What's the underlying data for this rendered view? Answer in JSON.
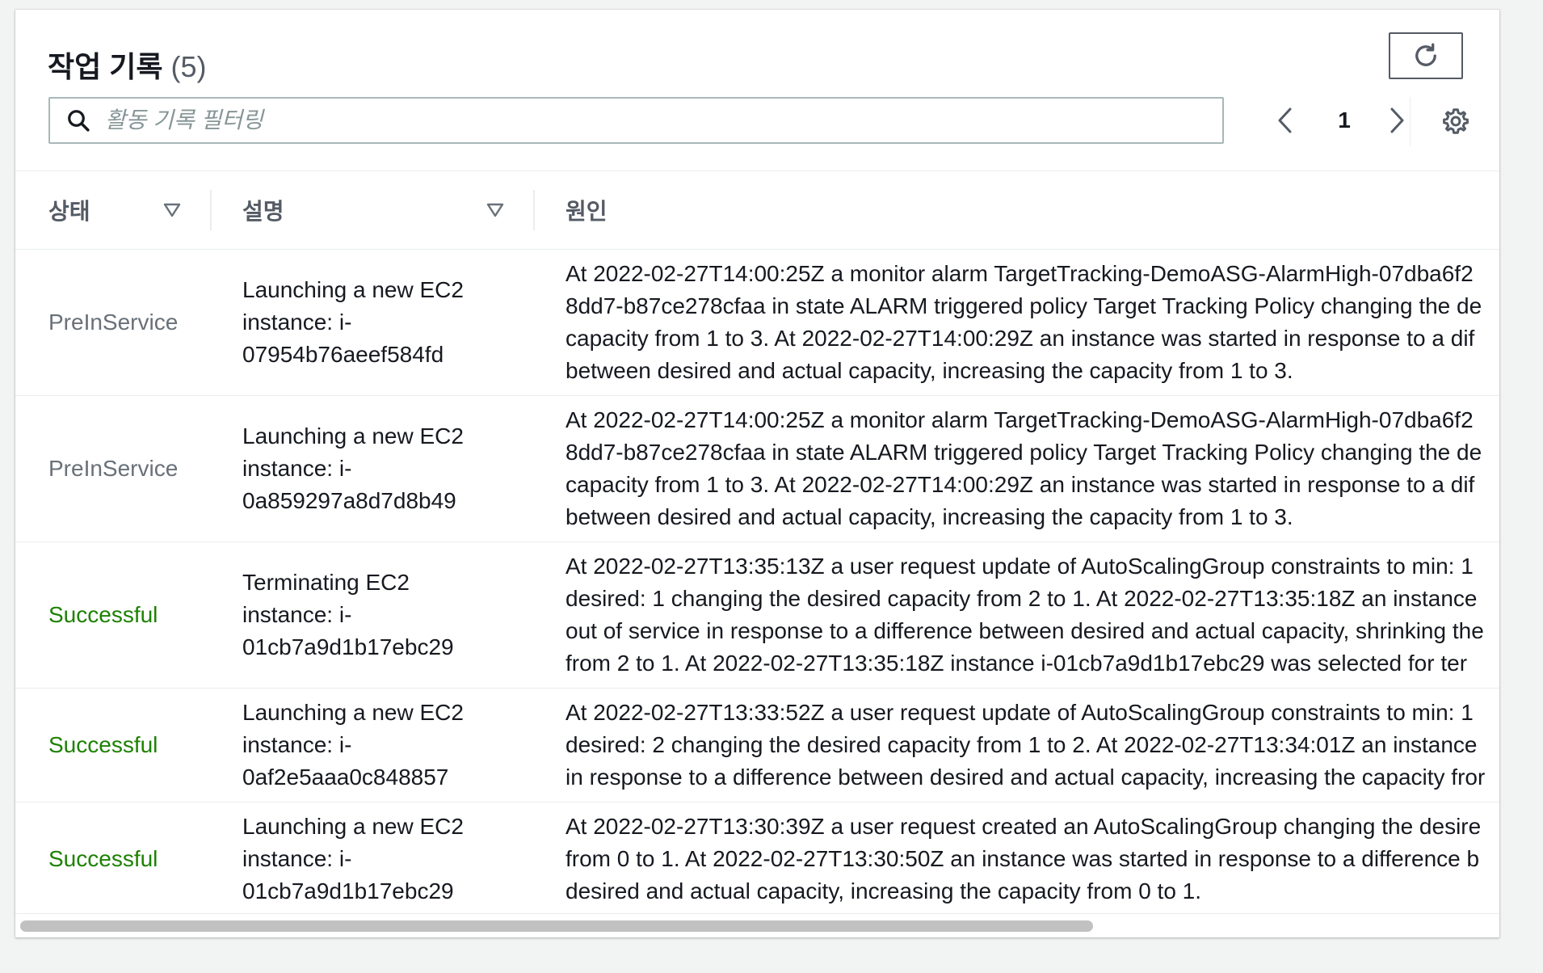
{
  "header": {
    "title": "작업 기록",
    "count": "(5)"
  },
  "search": {
    "placeholder": "활동 기록 필터링",
    "value": ""
  },
  "pagination": {
    "current_page": "1"
  },
  "icons": {
    "refresh": "refresh-icon",
    "search": "search-icon",
    "prev": "chevron-left-icon",
    "next": "chevron-right-icon",
    "settings": "gear-icon",
    "sort": "caret-down-icon"
  },
  "colors": {
    "status_preinservice": "#687078",
    "status_successful": "#1d8102"
  },
  "table": {
    "columns": [
      {
        "label": "상태",
        "sortable": true
      },
      {
        "label": "설명",
        "sortable": true
      },
      {
        "label": "원인",
        "sortable": false
      }
    ],
    "rows": [
      {
        "status": "PreInService",
        "status_type": "pre",
        "description": [
          "Launching a new EC2",
          "instance: i-",
          "07954b76aeef584fd"
        ],
        "cause": [
          "At 2022-02-27T14:00:25Z a monitor alarm TargetTracking-DemoASG-AlarmHigh-07dba6f2",
          "8dd7-b87ce278cfaa in state ALARM triggered policy Target Tracking Policy changing the de",
          "capacity from 1 to 3. At 2022-02-27T14:00:29Z an instance was started in response to a dif",
          "between desired and actual capacity, increasing the capacity from 1 to 3."
        ]
      },
      {
        "status": "PreInService",
        "status_type": "pre",
        "description": [
          "Launching a new EC2",
          "instance: i-",
          "0a859297a8d7d8b49"
        ],
        "cause": [
          "At 2022-02-27T14:00:25Z a monitor alarm TargetTracking-DemoASG-AlarmHigh-07dba6f2",
          "8dd7-b87ce278cfaa in state ALARM triggered policy Target Tracking Policy changing the de",
          "capacity from 1 to 3. At 2022-02-27T14:00:29Z an instance was started in response to a dif",
          "between desired and actual capacity, increasing the capacity from 1 to 3."
        ]
      },
      {
        "status": "Successful",
        "status_type": "ok",
        "description": [
          "Terminating EC2",
          "instance: i-",
          "01cb7a9d1b17ebc29"
        ],
        "cause": [
          "At 2022-02-27T13:35:13Z a user request update of AutoScalingGroup constraints to min: 1",
          "desired: 1 changing the desired capacity from 2 to 1. At 2022-02-27T13:35:18Z an instance",
          "out of service in response to a difference between desired and actual capacity, shrinking the",
          "from 2 to 1. At 2022-02-27T13:35:18Z instance i-01cb7a9d1b17ebc29 was selected for ter"
        ]
      },
      {
        "status": "Successful",
        "status_type": "ok",
        "description": [
          "Launching a new EC2",
          "instance: i-",
          "0af2e5aaa0c848857"
        ],
        "cause": [
          "At 2022-02-27T13:33:52Z a user request update of AutoScalingGroup constraints to min: 1",
          "desired: 2 changing the desired capacity from 1 to 2. At 2022-02-27T13:34:01Z an instance",
          "in response to a difference between desired and actual capacity, increasing the capacity fror"
        ]
      },
      {
        "status": "Successful",
        "status_type": "ok",
        "description": [
          "Launching a new EC2",
          "instance: i-",
          "01cb7a9d1b17ebc29"
        ],
        "cause": [
          "At 2022-02-27T13:30:39Z a user request created an AutoScalingGroup changing the desire",
          "from 0 to 1. At 2022-02-27T13:30:50Z an instance was started in response to a difference b",
          "desired and actual capacity, increasing the capacity from 0 to 1."
        ]
      }
    ]
  }
}
